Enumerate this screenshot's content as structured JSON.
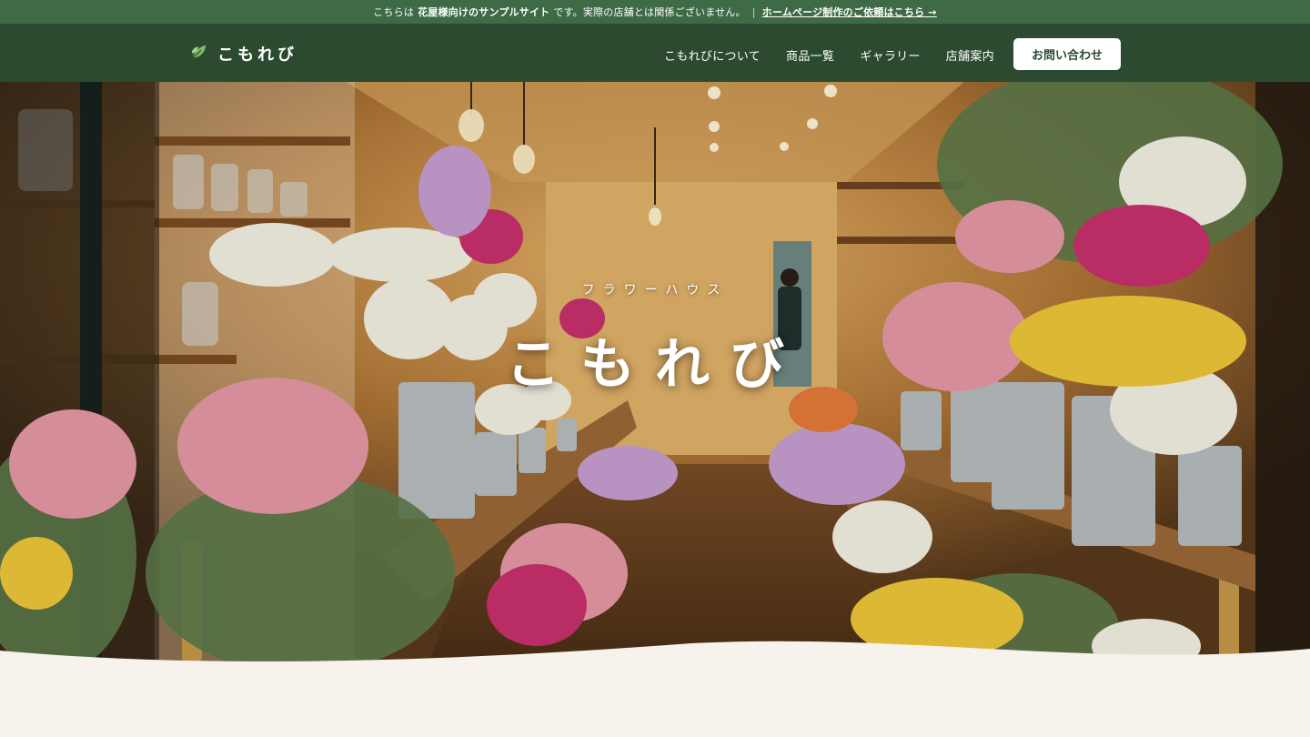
{
  "notice": {
    "prefix": "こちらは",
    "bold": "花屋様向けのサンプルサイト",
    "suffix": "です。実際の店舗とは関係ございません。",
    "separator": "|",
    "link": "ホームページ制作のご依頼はこちら →"
  },
  "header": {
    "logo_icon": "leaf-icon",
    "logo_text": "こもれび",
    "nav": [
      {
        "label": "こもれびについて"
      },
      {
        "label": "商品一覧"
      },
      {
        "label": "ギャラリー"
      },
      {
        "label": "店舗案内"
      }
    ],
    "contact_label": "お問い合わせ"
  },
  "hero": {
    "subtitle": "フラワーハウス",
    "title": "こもれび"
  },
  "colors": {
    "notice_bg": "#3e6a46",
    "header_bg": "#2b4a2f",
    "page_bg": "#f7f3ec",
    "button_bg": "#ffffff",
    "button_text": "#2b4a2f"
  }
}
